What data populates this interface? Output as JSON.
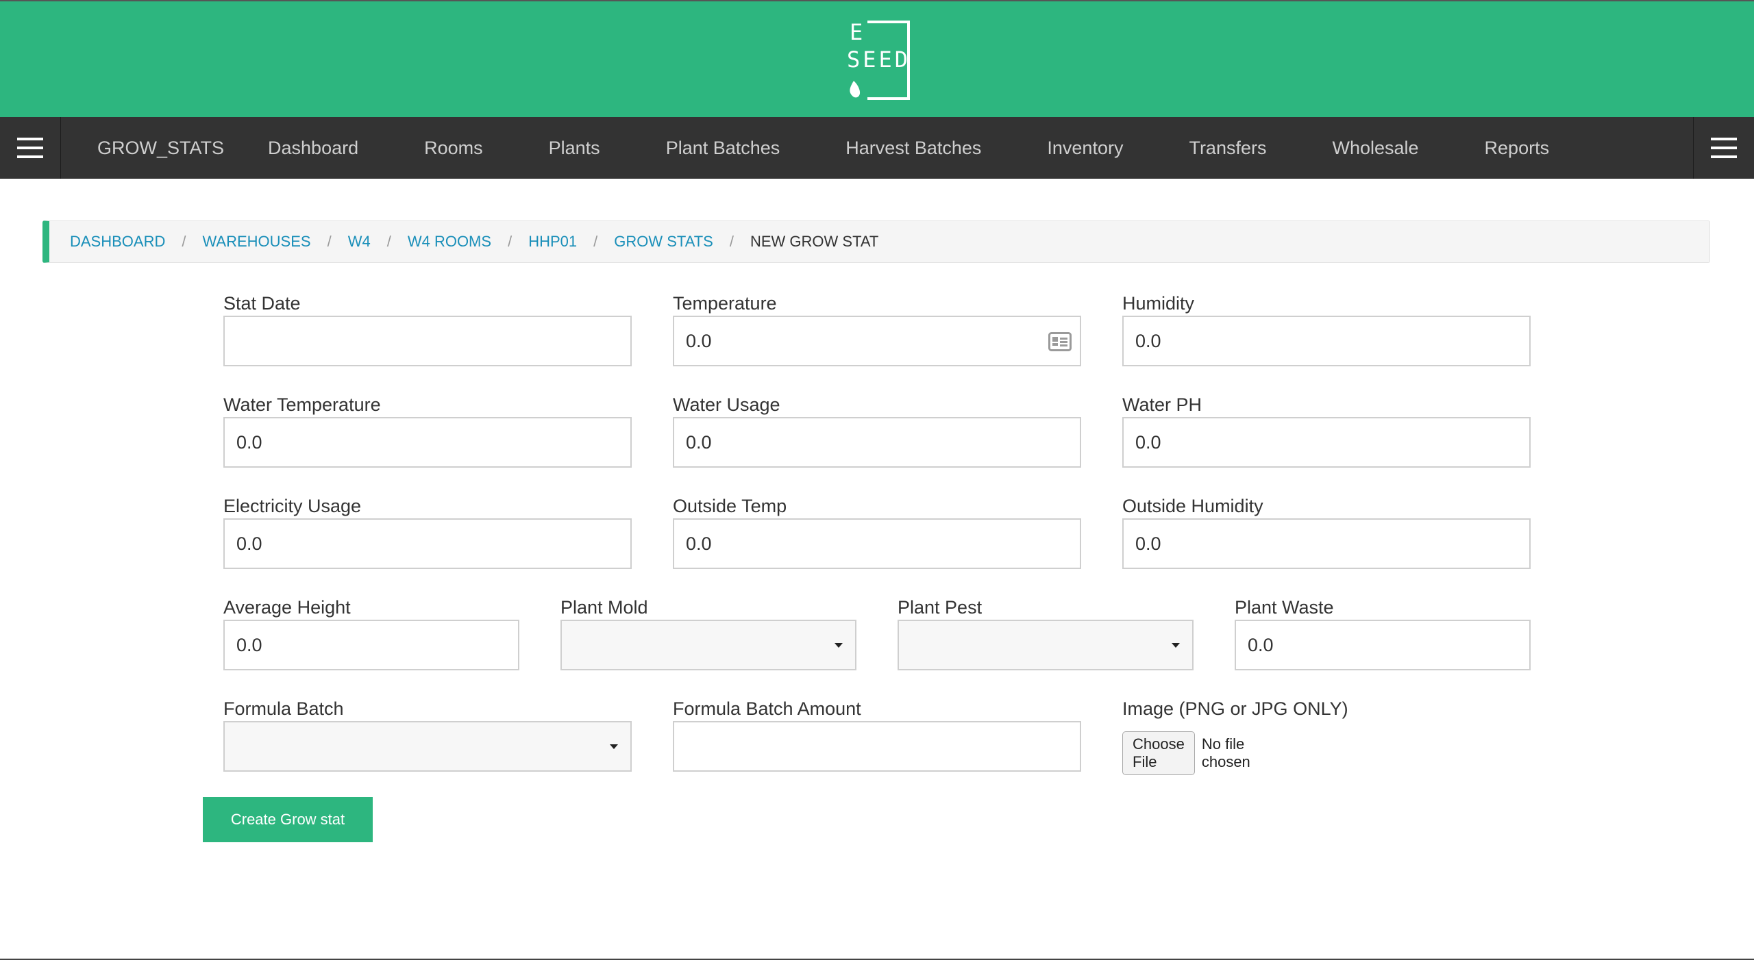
{
  "header": {
    "logo_top": "E",
    "logo_bottom": "SEED",
    "logo_color": "#2db67f"
  },
  "nav": {
    "menu_icon": "hamburger-icon",
    "items": [
      "GROW_STATS",
      "Dashboard",
      "Rooms",
      "Plants",
      "Plant Batches",
      "Harvest Batches",
      "Inventory",
      "Transfers",
      "Wholesale",
      "Reports"
    ],
    "bg_color": "#333333"
  },
  "breadcrumb": {
    "items": [
      "DASHBOARD",
      "WAREHOUSES",
      "W4",
      "W4 ROOMS",
      "HHP01",
      "GROW STATS",
      "NEW GROW STAT"
    ],
    "separator": "/"
  },
  "form": {
    "stat_date": {
      "label": "Stat Date",
      "value": ""
    },
    "temperature": {
      "label": "Temperature",
      "value": "0.0",
      "icon": "contact-card-icon"
    },
    "humidity": {
      "label": "Humidity",
      "value": "0.0"
    },
    "water_temperature": {
      "label": "Water Temperature",
      "value": "0.0"
    },
    "water_usage": {
      "label": "Water Usage",
      "value": "0.0"
    },
    "water_ph": {
      "label": "Water PH",
      "value": "0.0"
    },
    "electricity_usage": {
      "label": "Electricity Usage",
      "value": "0.0"
    },
    "outside_temp": {
      "label": "Outside Temp",
      "value": "0.0"
    },
    "outside_humidity": {
      "label": "Outside Humidity",
      "value": "0.0"
    },
    "average_height": {
      "label": "Average Height",
      "value": "0.0"
    },
    "plant_mold": {
      "label": "Plant Mold",
      "value": ""
    },
    "plant_pest": {
      "label": "Plant Pest",
      "value": ""
    },
    "plant_waste": {
      "label": "Plant Waste",
      "value": "0.0"
    },
    "formula_batch": {
      "label": "Formula Batch",
      "value": ""
    },
    "formula_batch_amount": {
      "label": "Formula Batch Amount",
      "value": ""
    },
    "image": {
      "label": "Image (PNG or JPG ONLY)",
      "button": "Choose File",
      "status": "No file chosen"
    },
    "submit_label": "Create Grow stat"
  },
  "colors": {
    "accent": "#2db67f",
    "link": "#1a8fb9"
  }
}
